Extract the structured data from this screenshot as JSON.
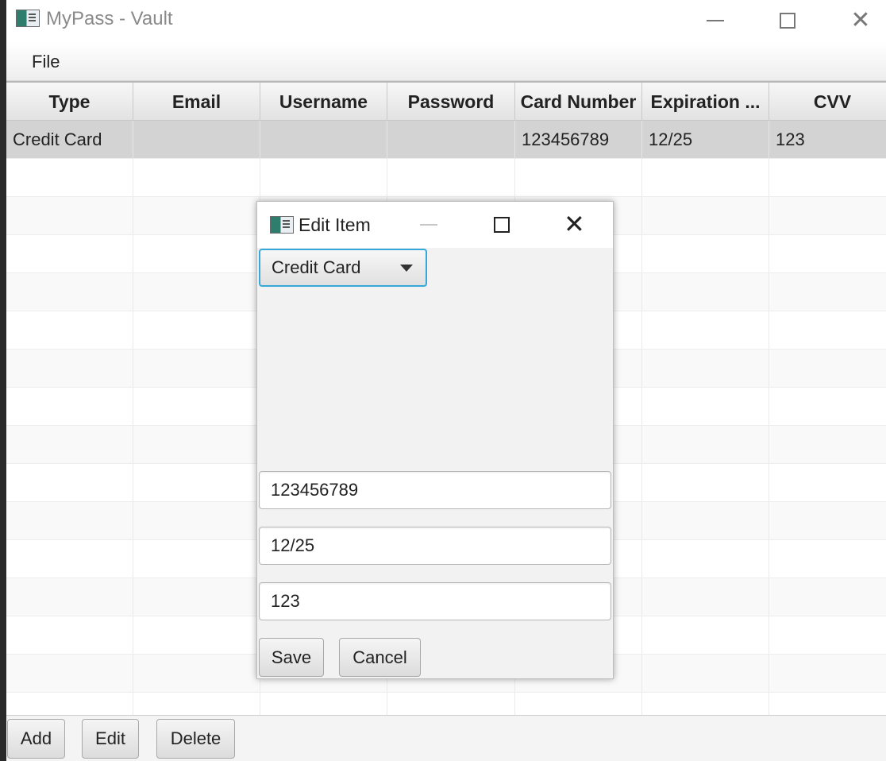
{
  "window": {
    "title": "MyPass - Vault"
  },
  "menu": {
    "file": "File"
  },
  "table": {
    "columns": [
      "Type",
      "Email",
      "Username",
      "Password",
      "Card Number",
      "Expiration ...",
      "CVV"
    ],
    "rows": [
      [
        "Credit Card",
        "",
        "",
        "",
        "123456789",
        "12/25",
        "123"
      ]
    ]
  },
  "buttons": {
    "add": "Add",
    "edit": "Edit",
    "delete": "Delete"
  },
  "dialog": {
    "title": "Edit Item",
    "type_selected": "Credit Card",
    "card_number": "123456789",
    "expiration": "12/25",
    "cvv": "123",
    "save": "Save",
    "cancel": "Cancel"
  },
  "colors": {
    "focus_accent": "#35a7d8",
    "selected_row": "#d3d3d3"
  },
  "icons": [
    "app-icon",
    "minimize-icon",
    "maximize-icon",
    "close-icon",
    "chevron-down-icon"
  ]
}
